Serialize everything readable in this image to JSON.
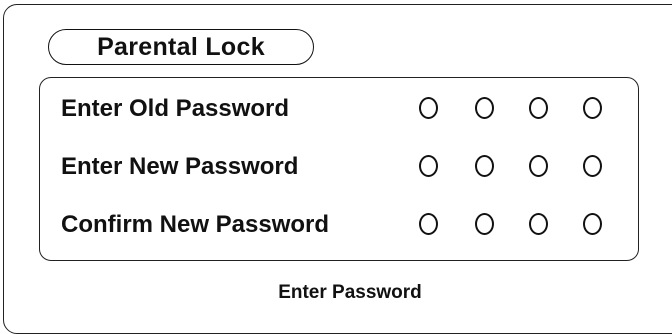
{
  "title": "Parental Lock",
  "fields": [
    {
      "label": "Enter Old Password",
      "digits_entered": 0,
      "digit_count": 4
    },
    {
      "label": "Enter New Password",
      "digits_entered": 0,
      "digit_count": 4
    },
    {
      "label": "Confirm New Password",
      "digits_entered": 0,
      "digit_count": 4
    }
  ],
  "status": "Enter Password"
}
